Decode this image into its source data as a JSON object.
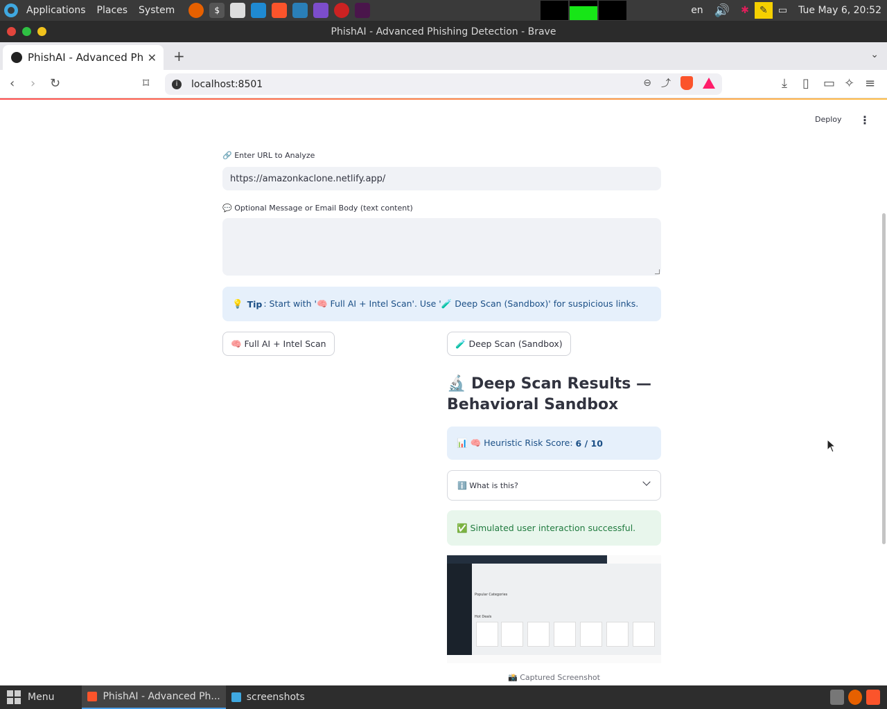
{
  "top_panel": {
    "applications": "Applications",
    "places": "Places",
    "system": "System",
    "keyboard_layout": "en",
    "clock": "Tue May 6, 20:52",
    "launchers": [
      "firefox-icon",
      "terminal-icon",
      "text-editor-icon",
      "vscode-icon",
      "brave-icon",
      "system-monitor-icon",
      "obsidian-icon",
      "cherry-icon",
      "slack-icon"
    ]
  },
  "window": {
    "title": "PhishAI - Advanced Phishing Detection - Brave"
  },
  "browser": {
    "tab_title": "PhishAI - Advanced Phish",
    "url": "localhost:8501"
  },
  "app": {
    "deploy_label": "Deploy",
    "url_label": "🔗 Enter URL to Analyze",
    "url_value": "https://amazonkaclone.netlify.app/",
    "message_label": "💬 Optional Message or Email Body (text content)",
    "message_value": "",
    "tip_prefix": "💡",
    "tip_bold": "Tip",
    "tip_text": ": Start with '🧠 Full AI + Intel Scan'. Use '🧪 Deep Scan (Sandbox)' for suspicious links.",
    "full_scan_button": "🧠 Full AI + Intel Scan",
    "deep_scan_button": "🧪 Deep Scan (Sandbox)",
    "results_title": "🔬 Deep Scan Results — Behavioral Sandbox",
    "score_label": "📊 🧠 Heuristic Risk Score:",
    "score_value": "6 / 10",
    "expander_label": "ℹ️ What is this?",
    "success_text": "✅ Simulated user interaction successful.",
    "screenshot_caption": "📸 Captured Screenshot",
    "screenshot_popular": "Popular Categories",
    "screenshot_hot": "Hot Deals"
  },
  "taskbar": {
    "menu": "Menu",
    "tasks": [
      {
        "label": "PhishAI - Advanced Ph..."
      },
      {
        "label": "screenshots"
      }
    ]
  },
  "colors": {
    "accent": "#ff4b4b",
    "info_bg": "#e6f0fb",
    "info_text": "#1b4f86",
    "success_bg": "#e8f6ec",
    "success_text": "#1f7a3e"
  }
}
